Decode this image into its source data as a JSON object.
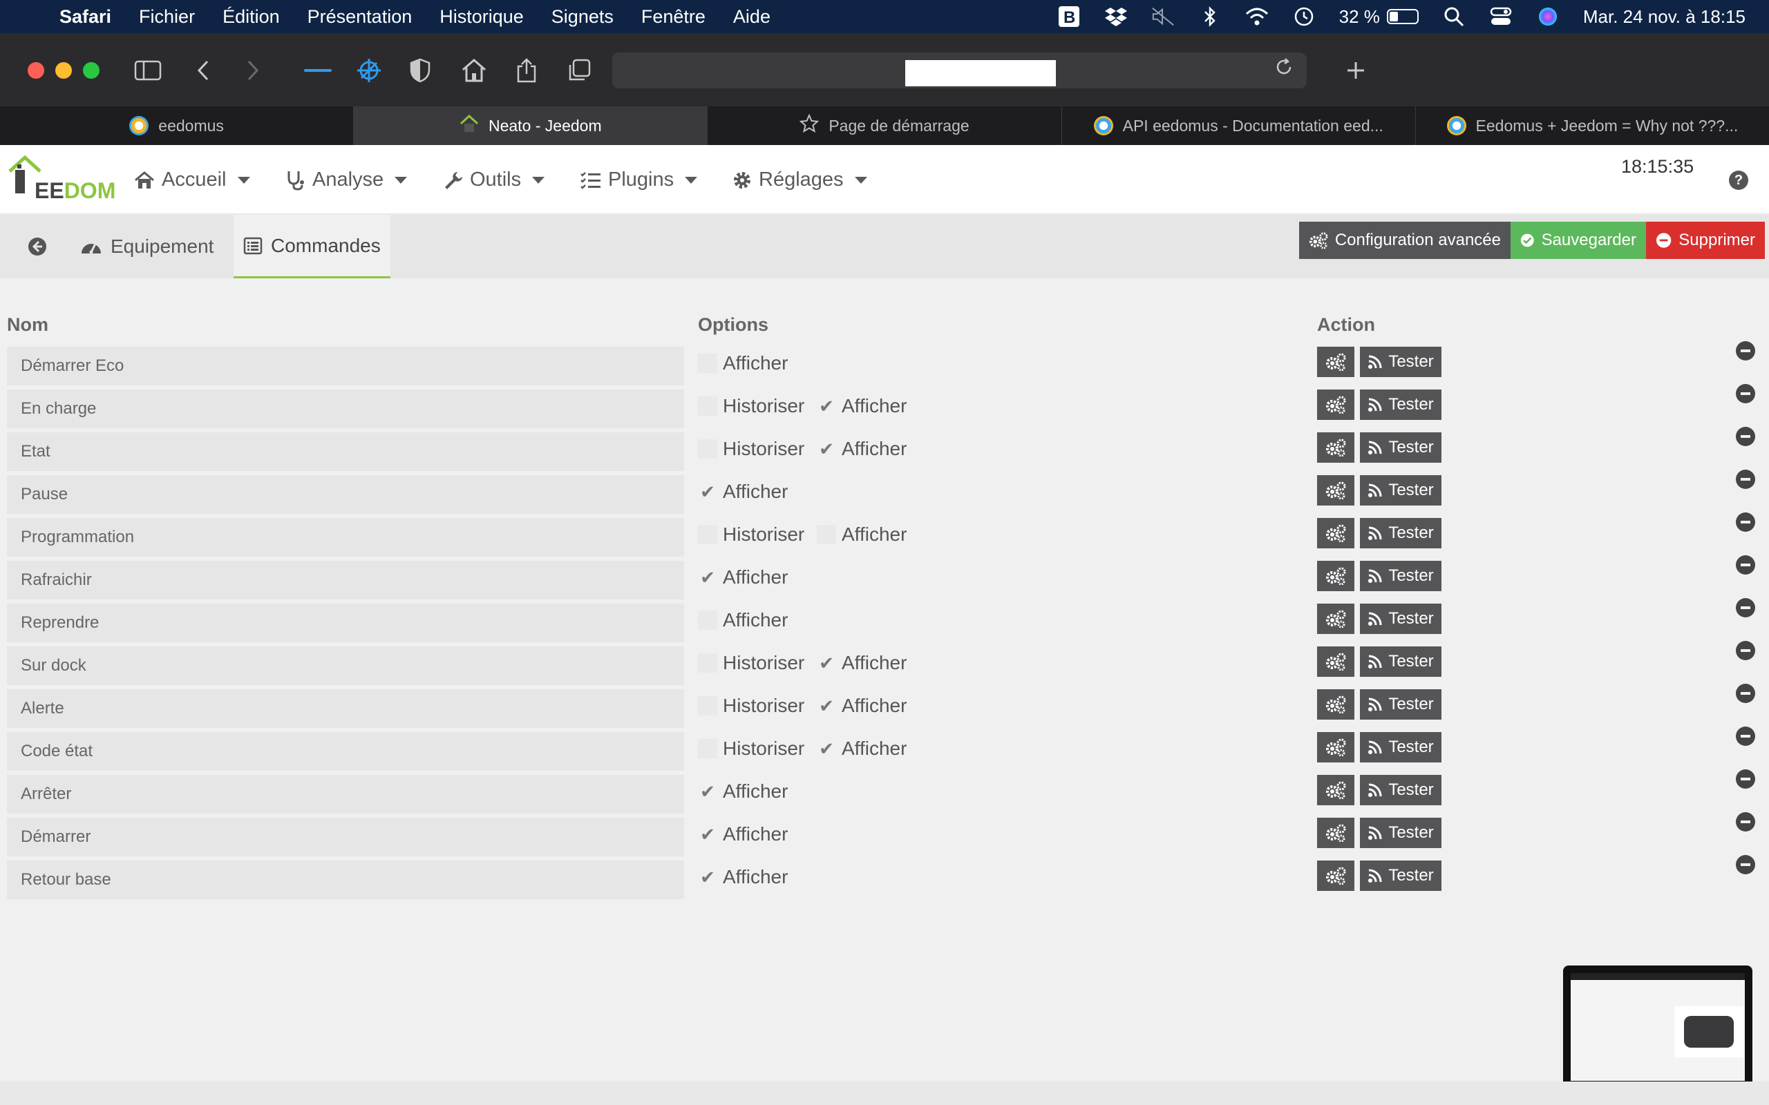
{
  "menubar": {
    "app": "Safari",
    "items": [
      "Fichier",
      "Édition",
      "Présentation",
      "Historique",
      "Signets",
      "Fenêtre",
      "Aide"
    ],
    "battery_label": "32 %",
    "battery_level": 0.32,
    "datetime": "Mar. 24 nov. à  18:15"
  },
  "tabs": [
    {
      "label": "eedomus",
      "icon": "eedomus-favicon"
    },
    {
      "label": "Neato - Jeedom",
      "icon": "jeedom-favicon"
    },
    {
      "label": "Page de démarrage",
      "icon": "star-icon"
    },
    {
      "label": "API eedomus - Documentation eed...",
      "icon": "eedomus-favicon"
    },
    {
      "label": "Eedomus + Jeedom = Why not ???...",
      "icon": "eedomus-favicon"
    }
  ],
  "active_tab": 1,
  "navbar": {
    "logo_prefix": "EE",
    "logo_suffix": "DOM",
    "items": [
      {
        "label": "Accueil",
        "icon": "home-icon"
      },
      {
        "label": "Analyse",
        "icon": "stethoscope-icon"
      },
      {
        "label": "Outils",
        "icon": "wrench-icon"
      },
      {
        "label": "Plugins",
        "icon": "tasks-icon"
      },
      {
        "label": "Réglages",
        "icon": "cog-icon"
      }
    ],
    "clock": "18:15:35",
    "help": "?"
  },
  "pagebar": {
    "back_icon": "arrow-circle-left-icon",
    "tab_equipement": "Equipement",
    "tab_commandes": "Commandes",
    "btn_config": "Configuration avancée",
    "btn_save": "Sauvegarder",
    "btn_delete": "Supprimer"
  },
  "table": {
    "headers": {
      "nom": "Nom",
      "options": "Options",
      "action": "Action"
    },
    "label_historiser": "Historiser",
    "label_afficher": "Afficher",
    "label_tester": "Tester",
    "check_glyph": "✔",
    "rows": [
      {
        "name": "Démarrer Eco",
        "historiser": null,
        "afficher": false
      },
      {
        "name": "En charge",
        "historiser": false,
        "afficher": true
      },
      {
        "name": "Etat",
        "historiser": false,
        "afficher": true
      },
      {
        "name": "Pause",
        "historiser": null,
        "afficher": true
      },
      {
        "name": "Programmation",
        "historiser": false,
        "afficher": false
      },
      {
        "name": "Rafraichir",
        "historiser": null,
        "afficher": true
      },
      {
        "name": "Reprendre",
        "historiser": null,
        "afficher": false
      },
      {
        "name": "Sur dock",
        "historiser": false,
        "afficher": true
      },
      {
        "name": "Alerte",
        "historiser": false,
        "afficher": true
      },
      {
        "name": "Code état",
        "historiser": false,
        "afficher": true
      },
      {
        "name": "Arrêter",
        "historiser": null,
        "afficher": true
      },
      {
        "name": "Démarrer",
        "historiser": null,
        "afficher": true
      },
      {
        "name": "Retour base",
        "historiser": null,
        "afficher": true
      }
    ]
  },
  "colors": {
    "menubar_bg": "#0f2444",
    "jeedom_green": "#8cc63f",
    "btn_dark": "#555557",
    "btn_green": "#5cb85c",
    "btn_red": "#d9302e"
  }
}
